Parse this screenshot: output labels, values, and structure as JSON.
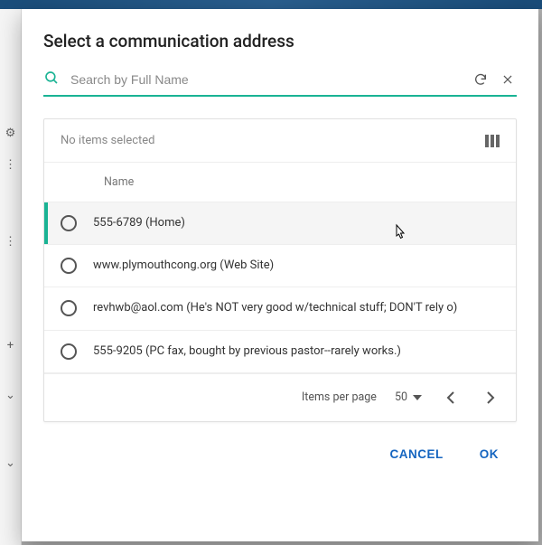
{
  "dialog": {
    "title": "Select a communication address"
  },
  "search": {
    "placeholder": "Search by Full Name",
    "value": ""
  },
  "table": {
    "selection_text": "No items selected",
    "column_header": "Name",
    "rows": [
      {
        "text": "555-6789 (Home)",
        "selected": true
      },
      {
        "text": "www.plymouthcong.org (Web Site)",
        "selected": false
      },
      {
        "text": "revhwb@aol.com (He's NOT very good w/technical stuff; DON'T rely o)",
        "selected": false
      },
      {
        "text": "555-9205 (PC fax, bought by previous pastor--rarely works.)",
        "selected": false
      }
    ]
  },
  "pager": {
    "label": "Items per page",
    "value": "50"
  },
  "actions": {
    "cancel": "CANCEL",
    "ok": "OK"
  }
}
